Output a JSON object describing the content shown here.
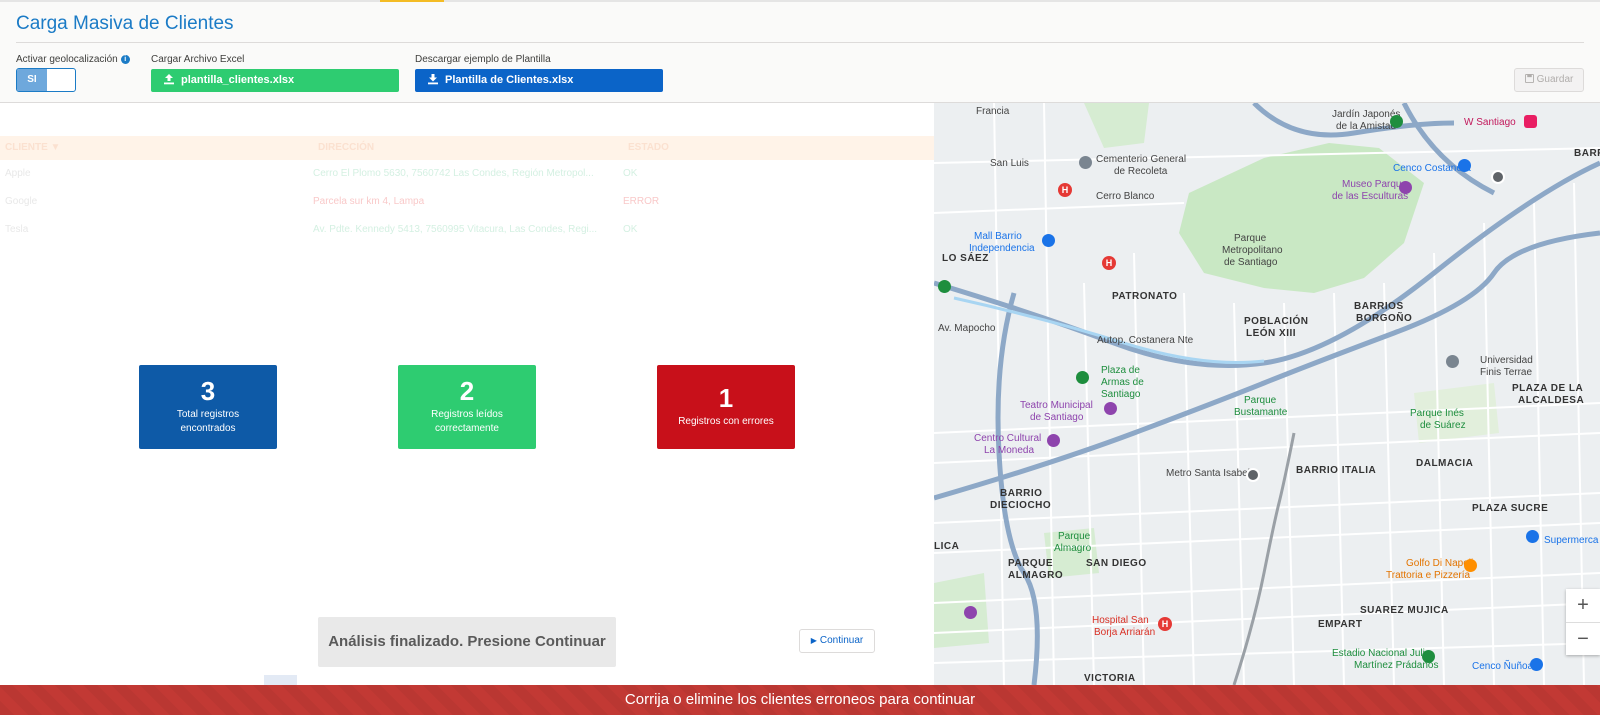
{
  "header": {
    "title": "Carga Masiva de Clientes",
    "geo_label": "Activar geolocalización",
    "geo_toggle_value": "SI",
    "upload_label": "Cargar Archivo Excel",
    "upload_file": "plantilla_clientes.xlsx",
    "download_label": "Descargar ejemplo de Plantilla",
    "download_file": "Plantilla de Clientes.xlsx",
    "save_label": "Guardar"
  },
  "table": {
    "columns": [
      "CLIENTE ▼",
      "DIRECCIÓN",
      "ESTADO"
    ],
    "rows": [
      {
        "cliente": "Apple",
        "direccion": "Cerro El Plomo 5630, 7560742 Las Condes, Región Metropol...",
        "estado": "OK"
      },
      {
        "cliente": "Google",
        "direccion": "Parcela sur km 4, Lampa",
        "estado": "ERROR"
      },
      {
        "cliente": "Tesla",
        "direccion": "Av. Pdte. Kennedy 5413, 7560995 Vitacura, Las Condes, Regi...",
        "estado": "OK"
      }
    ]
  },
  "summary": {
    "total": {
      "value": "3",
      "caption_line1": "Total registros",
      "caption_line2": "encontrados",
      "color": "#0e5aa7"
    },
    "ok": {
      "value": "2",
      "caption_line1": "Registros leídos",
      "caption_line2": "correctamente",
      "color": "#2ecc71"
    },
    "errors": {
      "value": "1",
      "caption": "Registros con errores",
      "color": "#c8101a"
    }
  },
  "status_message": "Análisis finalizado. Presione Continuar",
  "continue_label": "Continuar",
  "banner": "Corrija o elimine los clientes erroneos para continuar",
  "map": {
    "labels": {
      "francia": "Francia",
      "jardin1": "Jardín Japonés",
      "jardin2": "de la Amistad",
      "wsantiago": "W Santiago",
      "barra": "BARR",
      "sanluis": "San Luis",
      "cementerio1": "Cementerio General",
      "cementerio2": "de Recoleta",
      "cenco": "Cenco Costanera",
      "museo1": "Museo Parque",
      "museo2": "de las Esculturas",
      "cerroblanco": "Cerro Blanco",
      "mall1": "Mall Barrio",
      "mall2": "Independencia",
      "parque1": "Parque",
      "parque2": "Metropolitano",
      "parque3": "de Santiago",
      "losaez": "LO SÁEZ",
      "patronato": "PATRONATO",
      "barrios1": "BARRIOS",
      "barrios2": "BORGOÑO",
      "poblacion1": "POBLACIÓN",
      "poblacion2": "LEÓN XIII",
      "mapocho": "Av. Mapocho",
      "costanera": "Autop. Costanera Nte",
      "plazaarmas1": "Plaza de",
      "plazaarmas2": "Armas de",
      "plazaarmas3": "Santiago",
      "universidad1": "Universidad",
      "universidad2": "Finis Terrae",
      "plazaalc1": "PLAZA DE LA",
      "plazaalc2": "ALCALDESA",
      "teatro1": "Teatro Municipal",
      "teatro2": "de Santiago",
      "bustamante1": "Parque",
      "bustamante2": "Bustamante",
      "ines1": "Parque Inés",
      "ines2": "de Suárez",
      "cultural1": "Centro Cultural",
      "cultural2": "La Moneda",
      "santaisabel": "Metro Santa Isabel",
      "italia": "BARRIO ITALIA",
      "dalmacia": "DALMACIA",
      "dieciocho1": "BARRIO",
      "dieciocho2": "DIECIOCHO",
      "plazasucre": "PLAZA SUCRE",
      "almagro1": "Parque",
      "almagro2": "Almagro",
      "parquealmagro1": "PARQUE",
      "parquealmagro2": "ALMAGRO",
      "sandiego": "SAN DIEGO",
      "supermerca": "Supermerca",
      "golfo1": "Golfo Di Napoli",
      "golfo2": "Trattoria e Pizzería",
      "suarez": "SUAREZ MUJICA",
      "empart": "EMPART",
      "hospital1": "Hospital San",
      "hospital2": "Borja Arriarán",
      "estadio1": "Estadio Nacional Julio",
      "estadio2": "Martínez Prádanos",
      "cenconunoa": "Cenco Ñuñoa",
      "victoria": "VICTORIA",
      "lica": "LICA"
    },
    "zoom_in": "+",
    "zoom_out": "−"
  }
}
